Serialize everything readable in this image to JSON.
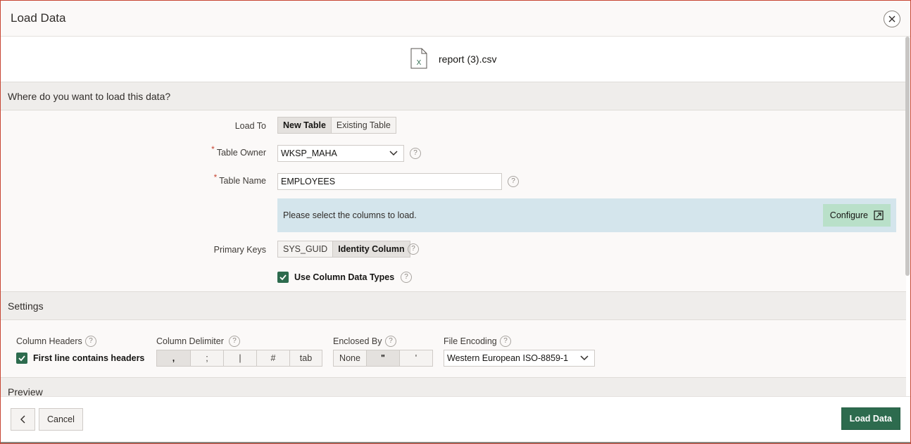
{
  "dialog": {
    "title": "Load Data",
    "close_icon": "close-icon"
  },
  "file": {
    "icon": "excel-file-icon",
    "name": "report (3).csv"
  },
  "load_section": {
    "header": "Where do you want to load this data?",
    "load_to": {
      "label": "Load To",
      "options": [
        "New Table",
        "Existing Table"
      ],
      "selected": "New Table"
    },
    "table_owner": {
      "label": "Table Owner",
      "value": "WKSP_MAHA"
    },
    "table_name": {
      "label": "Table Name",
      "value": "EMPLOYEES"
    },
    "info": {
      "text": "Please select the columns to load.",
      "configure_label": "Configure"
    },
    "primary_keys": {
      "label": "Primary Keys",
      "options": [
        "SYS_GUID",
        "Identity Column"
      ],
      "selected": "Identity Column"
    },
    "use_column_data_types": {
      "label": "Use Column Data Types",
      "checked": true
    },
    "required_mark": "*",
    "help_mark": "?"
  },
  "settings": {
    "header": "Settings",
    "column_headers": {
      "label": "Column Headers",
      "checkbox_label": "First line contains headers",
      "checked": true
    },
    "column_delimiter": {
      "label": "Column Delimiter",
      "options": [
        ",",
        ";",
        "|",
        "#",
        "tab"
      ],
      "selected": ","
    },
    "enclosed_by": {
      "label": "Enclosed By",
      "options": [
        "None",
        "\"",
        "'"
      ],
      "selected": "\""
    },
    "file_encoding": {
      "label": "File Encoding",
      "value": "Western European ISO-8859-1"
    }
  },
  "preview": {
    "header": "Preview"
  },
  "footer": {
    "cancel_label": "Cancel",
    "load_label": "Load Data"
  },
  "colors": {
    "accent_green": "#2d6b4e",
    "info_bg": "#d4e5ec",
    "configure_bg": "#b9e0c9",
    "required": "#c74634"
  }
}
